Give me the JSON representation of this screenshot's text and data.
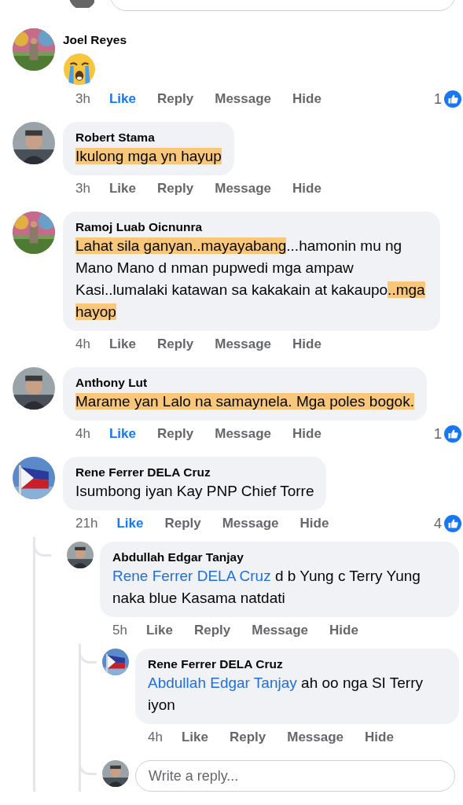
{
  "comments": [
    {
      "author": "Joel Reyes",
      "kind": "emoji",
      "time": "3h",
      "liked": true,
      "actions": [
        "Like",
        "Reply",
        "Message",
        "Hide"
      ],
      "like_count": "1"
    },
    {
      "author": "Robert Stama",
      "kind": "text",
      "body": [
        {
          "text": "Ikulong mga yn hayup",
          "highlighted": true
        }
      ],
      "time": "3h",
      "liked": false,
      "actions": [
        "Like",
        "Reply",
        "Message",
        "Hide"
      ]
    },
    {
      "author": "Ramoj Luab Oicnunra",
      "kind": "text",
      "body": [
        {
          "text": "Lahat sila ganyan..mayayabang",
          "highlighted": true
        },
        {
          "text": "...hamonin mu ng Mano Mano d nman pupwedi mga ampaw Kasi..lumalaki katawan sa kakakain at kakaupo",
          "highlighted": false
        },
        {
          "text": "..mga hayop",
          "highlighted": true
        }
      ],
      "time": "4h",
      "liked": false,
      "actions": [
        "Like",
        "Reply",
        "Message",
        "Hide"
      ]
    },
    {
      "author": "Anthony Lut",
      "kind": "text",
      "body": [
        {
          "text": "Marame yan Lalo na samaynela. Mga poles bogok.",
          "highlighted": true
        }
      ],
      "time": "4h",
      "liked": true,
      "actions": [
        "Like",
        "Reply",
        "Message",
        "Hide"
      ],
      "like_count": "1"
    },
    {
      "author": "Rene Ferrer DELA Cruz",
      "kind": "text",
      "body": [
        {
          "text": "Isumbong iyan Kay PNP Chief Torre",
          "highlighted": false
        }
      ],
      "time": "21h",
      "liked": true,
      "actions": [
        "Like",
        "Reply",
        "Message",
        "Hide"
      ],
      "like_count": "4",
      "children": [
        {
          "author": "Abdullah Edgar Tanjay",
          "kind": "text",
          "mention": "Rene Ferrer DELA Cruz",
          "body": [
            {
              "text": " d b Yung c Terry Yung naka blue Kasama natdati",
              "highlighted": false
            }
          ],
          "time": "5h",
          "liked": false,
          "actions": [
            "Like",
            "Reply",
            "Message",
            "Hide"
          ],
          "children": [
            {
              "author": "Rene Ferrer DELA Cruz",
              "kind": "text",
              "mention": "Abdullah Edgar Tanjay",
              "body": [
                {
                  "text": " ah oo nga SI Terry iyon",
                  "highlighted": false
                }
              ],
              "time": "4h",
              "liked": false,
              "actions": [
                "Like",
                "Reply",
                "Message",
                "Hide"
              ]
            }
          ],
          "reply_field": {
            "placeholder": "Write a reply..."
          }
        }
      ]
    }
  ]
}
